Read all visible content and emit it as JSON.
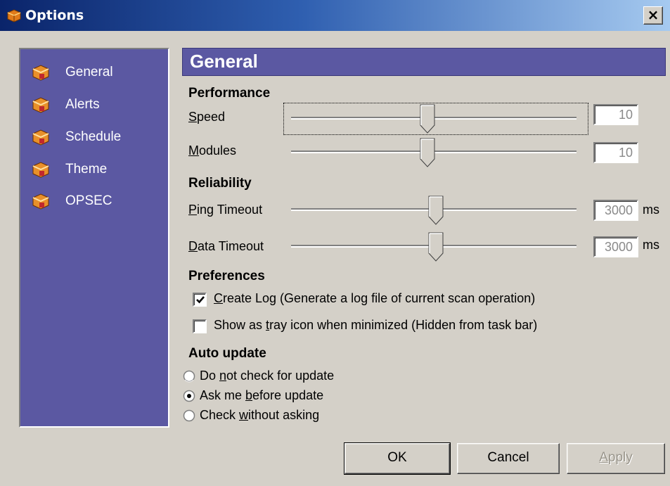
{
  "window": {
    "title": "Options",
    "close_label": "×"
  },
  "sidebar": {
    "items": [
      {
        "label": "General"
      },
      {
        "label": "Alerts"
      },
      {
        "label": "Schedule"
      },
      {
        "label": "Theme"
      },
      {
        "label": "OPSEC"
      }
    ]
  },
  "main": {
    "header": "General",
    "performance": {
      "title": "Performance",
      "speed": {
        "label_underlined": "S",
        "label_rest": "peed",
        "value": "10",
        "slider_fraction": 0.5
      },
      "modules": {
        "label_underlined": "M",
        "label_rest": "odules",
        "value": "10",
        "slider_fraction": 0.5
      }
    },
    "reliability": {
      "title": "Reliability",
      "ping_timeout": {
        "label_underlined": "P",
        "label_rest": "ing Timeout",
        "value": "3000",
        "unit": "ms",
        "slider_fraction": 0.5
      },
      "data_timeout": {
        "label_underlined": "D",
        "label_rest": "ata Timeout",
        "value": "3000",
        "unit": "ms",
        "slider_fraction": 0.5
      }
    },
    "preferences": {
      "title": "Preferences",
      "create_log": {
        "checked": true,
        "underlined": "C",
        "rest": "reate Log  (Generate a log file of current scan operation)"
      },
      "tray_icon": {
        "checked": false,
        "before": "Show as ",
        "underlined": "t",
        "rest": "ray icon when minimized (Hidden from task bar)"
      }
    },
    "auto_update": {
      "title": "Auto update",
      "options": [
        {
          "before": "Do ",
          "underlined": "n",
          "rest": "ot check for update",
          "selected": false
        },
        {
          "before": "Ask me ",
          "underlined": "b",
          "rest": "efore update",
          "selected": true
        },
        {
          "before": "Check ",
          "underlined": "w",
          "rest": "ithout asking",
          "selected": false
        }
      ]
    }
  },
  "buttons": {
    "ok": "OK",
    "cancel": "Cancel",
    "apply_underlined": "A",
    "apply_rest": "pply"
  }
}
